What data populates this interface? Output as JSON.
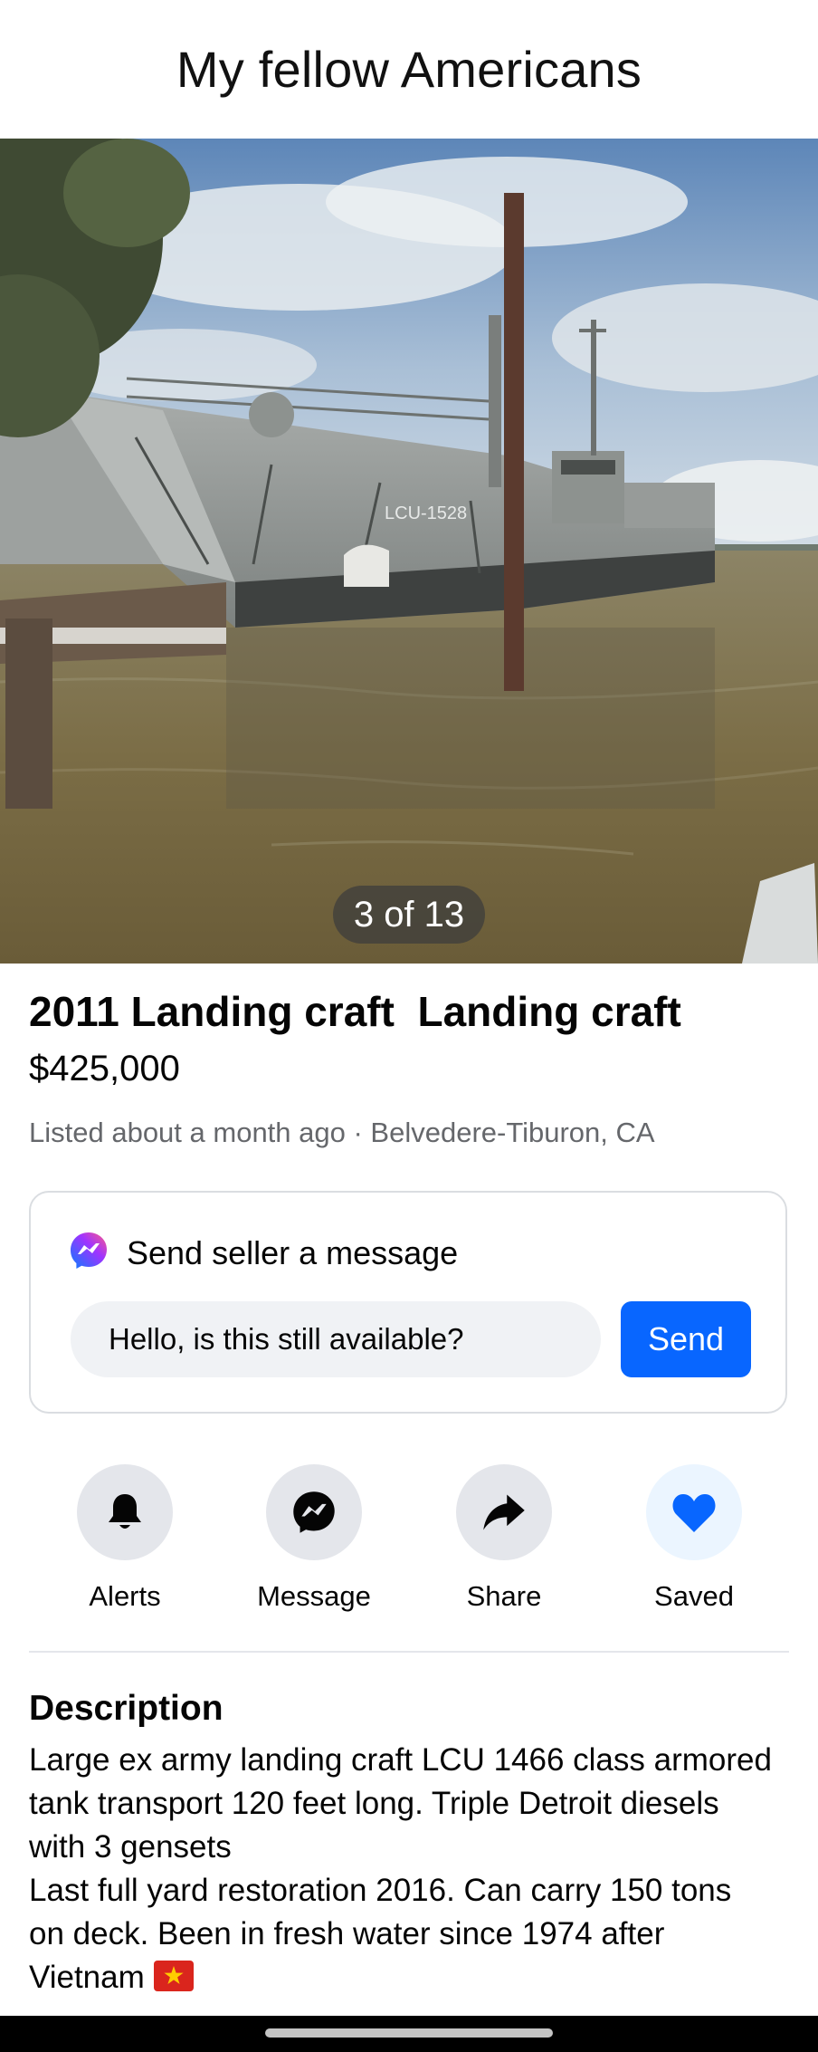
{
  "header": {
    "title": "My fellow Americans"
  },
  "gallery": {
    "counter": "3 of 13",
    "hull_marking": "LCU-1528"
  },
  "listing": {
    "title": "2011 Landing craft  Landing craft",
    "price": "$425,000",
    "meta": "Listed about a month ago · Belvedere-Tiburon, CA"
  },
  "message_card": {
    "heading": "Send seller a message",
    "input_value": "Hello, is this still available?",
    "send_label": "Send",
    "accent": "#0866ff"
  },
  "actions": [
    {
      "label": "Alerts",
      "icon": "bell-icon"
    },
    {
      "label": "Message",
      "icon": "messenger-icon"
    },
    {
      "label": "Share",
      "icon": "share-arrow-icon"
    },
    {
      "label": "Saved",
      "icon": "heart-icon",
      "active": true
    }
  ],
  "description": {
    "heading": "Description",
    "lines": [
      "Large ex army landing craft LCU 1466 class armored",
      "tank transport 120 feet long. Triple Detroit diesels",
      "with 3 gensets",
      "Last full yard restoration 2016. Can carry 150 tons",
      "on deck. Been in fresh water since 1974 after",
      "Vietnam"
    ],
    "emoji": "vietnam-flag-icon"
  }
}
